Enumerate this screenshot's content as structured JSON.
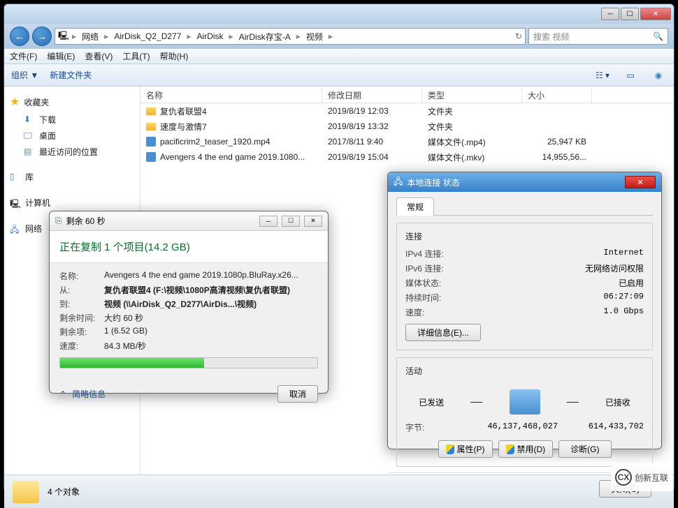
{
  "breadcrumb": [
    "网络",
    "AirDisk_Q2_D277",
    "AirDisk",
    "AirDisk存宝-A",
    "视频"
  ],
  "search_placeholder": "搜索 视频",
  "menubar": [
    "文件(F)",
    "编辑(E)",
    "查看(V)",
    "工具(T)",
    "帮助(H)"
  ],
  "toolbar": {
    "organize": "组织 ▼",
    "new_folder": "新建文件夹"
  },
  "sidebar": {
    "favorites": {
      "label": "收藏夹",
      "items": [
        "下载",
        "桌面",
        "最近访问的位置"
      ]
    },
    "libraries": "库",
    "computer": "计算机",
    "network": "网络"
  },
  "columns": {
    "name": "名称",
    "date": "修改日期",
    "type": "类型",
    "size": "大小"
  },
  "files": [
    {
      "name": "复仇者联盟4",
      "date": "2019/8/19 12:03",
      "type": "文件夹",
      "size": ""
    },
    {
      "name": "速度与激情7",
      "date": "2019/8/19 13:32",
      "type": "文件夹",
      "size": ""
    },
    {
      "name": "pacificrim2_teaser_1920.mp4",
      "date": "2017/8/11 9:40",
      "type": "媒体文件(.mp4)",
      "size": "25,947 KB"
    },
    {
      "name": "Avengers 4 the end game 2019.1080...",
      "date": "2019/8/19 15:04",
      "type": "媒体文件(.mkv)",
      "size": "14,955,56..."
    }
  ],
  "status_count": "4 个对象",
  "copy": {
    "title": "剩余 60 秒",
    "header": "正在复制 1 个项目(14.2 GB)",
    "rows": {
      "name_l": "名称:",
      "name_v": "Avengers 4 the end game 2019.1080p.BluRay.x26...",
      "from_l": "从:",
      "from_v": "复仇者联盟4 (F:\\视频\\1080P高清视频\\复仇者联盟)",
      "to_l": "到:",
      "to_v": "视频 (\\\\AirDisk_Q2_D277\\AirDis...\\视频)",
      "time_l": "剩余时间:",
      "time_v": "大约 60 秒",
      "items_l": "剩余项:",
      "items_v": "1 (6.52 GB)",
      "speed_l": "速度:",
      "speed_v": "84.3 MB/秒"
    },
    "expand": "简略信息",
    "cancel": "取消"
  },
  "netstatus": {
    "title": "本地连接 状态",
    "tab": "常规",
    "conn_group": "连接",
    "rows": {
      "ipv4_l": "IPv4 连接:",
      "ipv4_v": "Internet",
      "ipv6_l": "IPv6 连接:",
      "ipv6_v": "无网络访问权限",
      "media_l": "媒体状态:",
      "media_v": "已启用",
      "dur_l": "持续时间:",
      "dur_v": "06:27:09",
      "speed_l": "速度:",
      "speed_v": "1.0 Gbps"
    },
    "details": "详细信息(E)...",
    "activity_group": "活动",
    "sent": "已发送",
    "recv": "已接收",
    "bytes_l": "字节:",
    "bytes_sent": "46,137,468,027",
    "bytes_recv": "614,433,702",
    "props": "属性(P)",
    "disable": "禁用(D)",
    "diag": "诊断(G)",
    "close": "关闭(C)"
  },
  "watermark": "创新互联"
}
